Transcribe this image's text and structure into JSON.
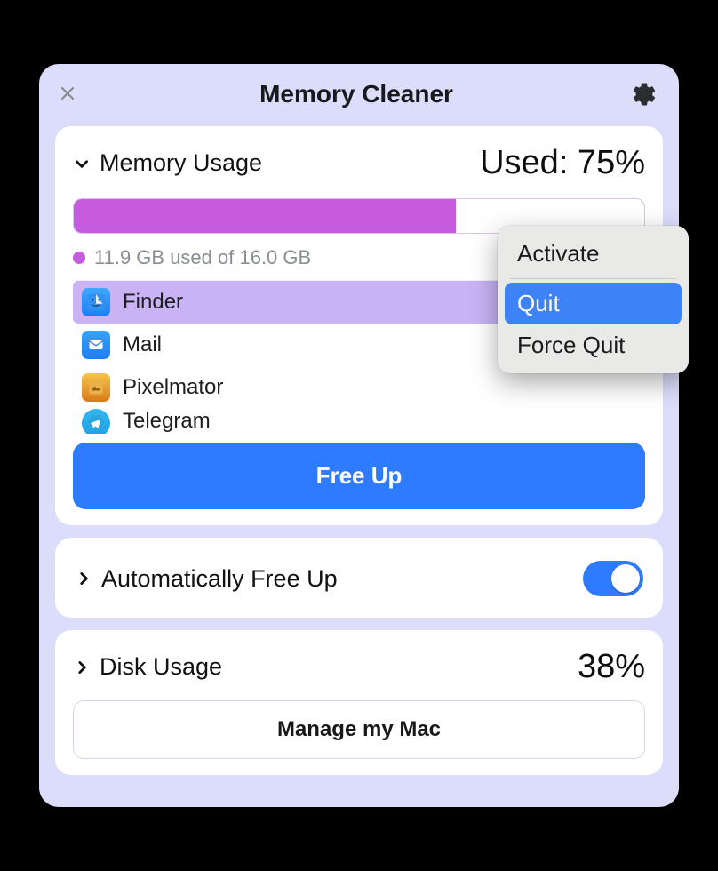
{
  "header": {
    "title": "Memory Cleaner"
  },
  "memory": {
    "section_label": "Memory Usage",
    "used_label": "Used: 75%",
    "progress_percent": 67,
    "detail": "11.9 GB used of 16.0 GB",
    "apps": [
      {
        "name": "Finder"
      },
      {
        "name": "Mail"
      },
      {
        "name": "Pixelmator"
      },
      {
        "name": "Telegram"
      }
    ],
    "free_up_label": "Free Up"
  },
  "auto": {
    "label": "Automatically Free Up",
    "enabled": true
  },
  "disk": {
    "section_label": "Disk Usage",
    "percent_label": "38%",
    "manage_label": "Manage my Mac"
  },
  "context_menu": {
    "activate": "Activate",
    "quit": "Quit",
    "force_quit": "Force Quit"
  },
  "colors": {
    "accent": "#2f7bff",
    "usage_bar": "#c65be0",
    "window_bg": "#dcddfb"
  }
}
